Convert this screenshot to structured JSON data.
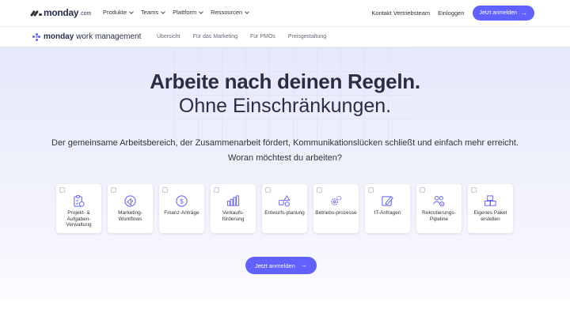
{
  "brand": {
    "name": "monday",
    "suffix": ".com"
  },
  "nav": {
    "menu": [
      "Produkte",
      "Teams",
      "Plattform",
      "Ressourcen"
    ],
    "contact": "Kontakt Vertriebsteam",
    "login": "Einloggen",
    "cta": "Jetzt anmelden",
    "cta_arrow": "→"
  },
  "subnav": {
    "product_bold": "monday",
    "product_rest": " work management",
    "links": [
      "Übersicht",
      "Für das Marketing",
      "Für PMOs",
      "Preisgestaltung"
    ]
  },
  "hero": {
    "title": "Arbeite nach deinen Regeln.",
    "subtitle": "Ohne Einschränkungen.",
    "description_line1": "Der gemeinsame Arbeitsbereich, der Zusammenarbeit fördert, Kommunikationslücken schließt und einfach mehr erreicht.",
    "description_line2": "Woran möchtest du arbeiten?",
    "cards": [
      {
        "label": "Projekt- & Aufgaben-Verwaltung",
        "icon": "clipboard-icon"
      },
      {
        "label": "Marketing-Workflows",
        "icon": "megaphone-icon"
      },
      {
        "label": "Finanz-Anträge",
        "icon": "dollar-coin-icon"
      },
      {
        "label": "Verkaufs-förderung",
        "icon": "bar-chart-icon"
      },
      {
        "label": "Entwurfs-planung",
        "icon": "shapes-icon"
      },
      {
        "label": "Betriebs-prozesse",
        "icon": "gears-icon"
      },
      {
        "label": "IT-Anfragen",
        "icon": "edit-icon"
      },
      {
        "label": "Rekrutierungs-Pipeline",
        "icon": "people-icon"
      },
      {
        "label": "Eigenes Paket erstellen",
        "icon": "blocks-icon"
      }
    ],
    "cta": "Jetzt anmelden",
    "cta_arrow": "→"
  },
  "colors": {
    "accent": "#6161ff",
    "text": "#323338"
  }
}
